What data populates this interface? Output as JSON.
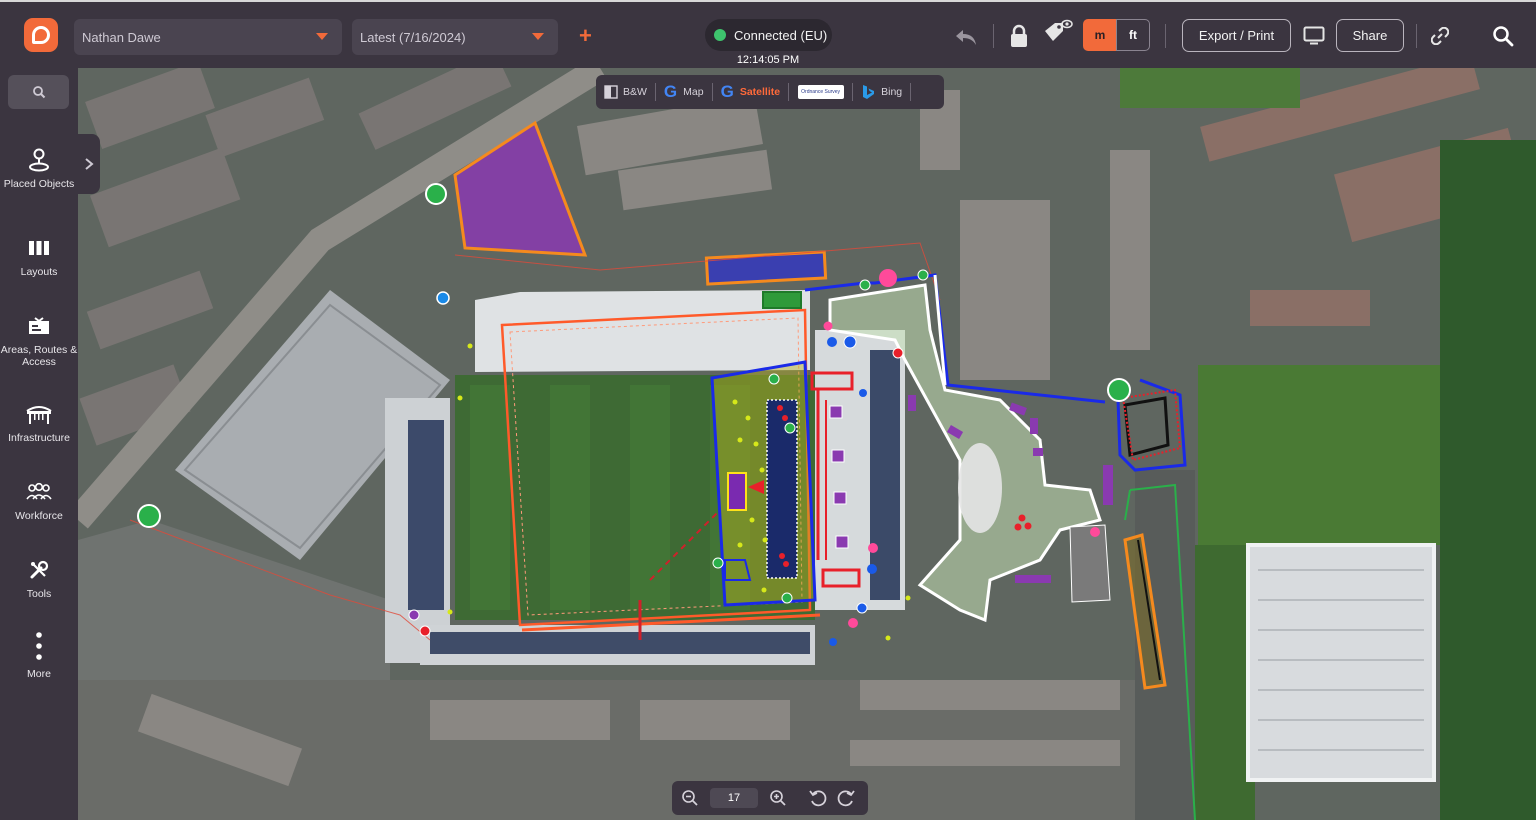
{
  "header": {
    "user_select": "Nathan Dawe",
    "version_select": "Latest (7/16/2024)",
    "connection_status": "Connected (EU)",
    "clock": "12:14:05 PM",
    "unit_metric": "m",
    "unit_imperial": "ft",
    "export_label": "Export / Print",
    "share_label": "Share",
    "accent_color": "#f26a3a",
    "status_color": "#3ec46d"
  },
  "sidebar": {
    "items": [
      {
        "label": "Placed Objects",
        "icon": "pin-person-icon"
      },
      {
        "label": "Layouts",
        "icon": "columns-icon"
      },
      {
        "label": "Areas, Routes & Access",
        "icon": "map-board-icon"
      },
      {
        "label": "Infrastructure",
        "icon": "fence-icon"
      },
      {
        "label": "Workforce",
        "icon": "people-icon"
      },
      {
        "label": "Tools",
        "icon": "tools-icon"
      },
      {
        "label": "More",
        "icon": "more-vertical-icon"
      }
    ]
  },
  "map_layers": [
    {
      "label": "B&W",
      "active": false
    },
    {
      "label": "Map",
      "active": false
    },
    {
      "label": "Satellite",
      "active": true
    },
    {
      "label": "Ordnance Survey",
      "active": false
    },
    {
      "label": "Bing",
      "active": false
    }
  ],
  "zoom": {
    "level": "17"
  }
}
